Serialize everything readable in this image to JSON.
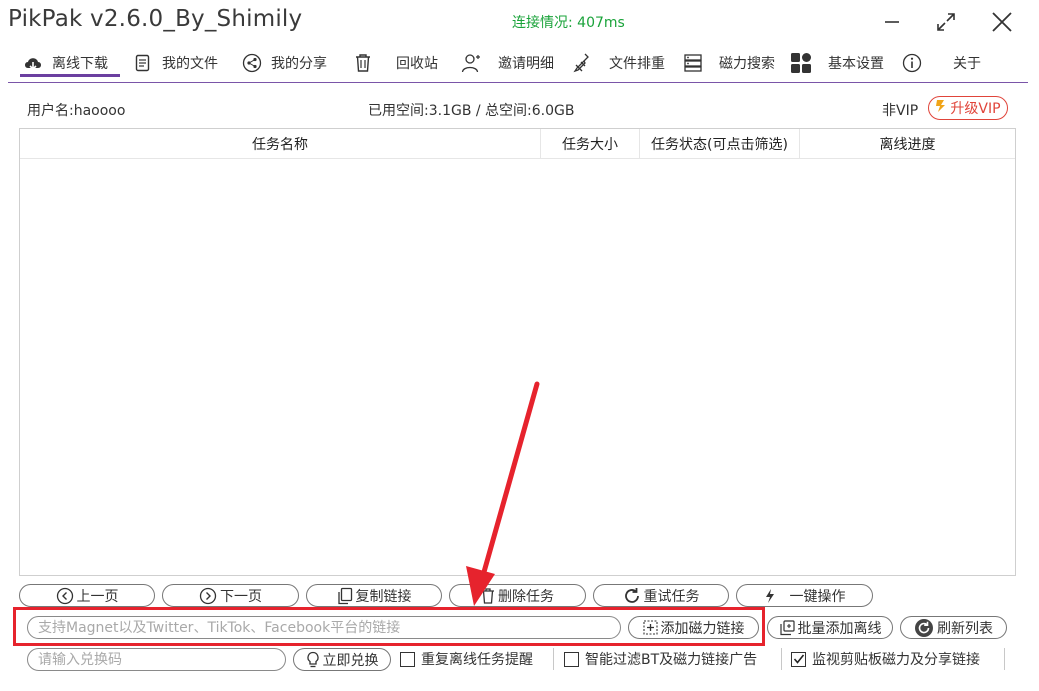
{
  "window": {
    "title": "PikPak v2.6.0_By_Shimily",
    "connection": "连接情况: 407ms"
  },
  "tabs": [
    {
      "label": "离线下载",
      "icon": "cloud-download-icon",
      "active": true
    },
    {
      "label": "我的文件",
      "icon": "document-icon"
    },
    {
      "label": "我的分享",
      "icon": "share-icon"
    },
    {
      "label": "回收站",
      "icon": "trash-icon"
    },
    {
      "label": "邀请明细",
      "icon": "user-icon"
    },
    {
      "label": "文件排重",
      "icon": "broom-icon"
    },
    {
      "label": "磁力搜索",
      "icon": "server-icon"
    },
    {
      "label": "基本设置",
      "icon": "grid-icon"
    },
    {
      "label": "关于",
      "icon": "info-icon"
    }
  ],
  "info": {
    "username": "用户名:haoooo",
    "space": "已用空间:3.1GB / 总空间:6.0GB",
    "vip_status": "非VIP",
    "upgrade_label": "升级VIP"
  },
  "table": {
    "columns": [
      "任务名称",
      "任务大小",
      "任务状态(可点击筛选)",
      "离线进度"
    ]
  },
  "buttons": {
    "prev": "上一页",
    "next": "下一页",
    "copy": "复制链接",
    "delete": "删除任务",
    "retry": "重试任务",
    "oneclick": "一键操作",
    "add_magnet": "添加磁力链接",
    "batch_add": "批量添加离线",
    "refresh": "刷新列表",
    "redeem": "立即兑换"
  },
  "inputs": {
    "magnet_placeholder": "支持Magnet以及Twitter、TikTok、Facebook平台的链接",
    "code_placeholder": "请输入兑换码"
  },
  "checks": {
    "repeat_remind": {
      "label": "重复离线任务提醒",
      "checked": false
    },
    "smart_filter": {
      "label": "智能过滤BT及磁力链接广告",
      "checked": false
    },
    "clipboard_monitor": {
      "label": "监视剪贴板磁力及分享链接",
      "checked": true
    }
  },
  "colors": {
    "accent": "#6b3fa0",
    "connection": "#1aa33a",
    "vip": "#e0443a",
    "highlight": "#e6232d"
  }
}
